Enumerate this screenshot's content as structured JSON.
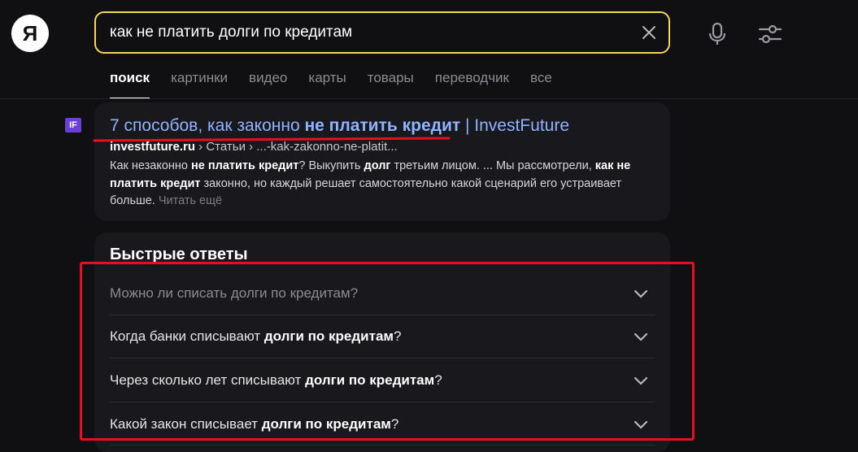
{
  "logo": {
    "letter": "Я"
  },
  "search": {
    "value": "как не платить долги по кредитам"
  },
  "tabs": [
    {
      "label": "поиск",
      "active": true
    },
    {
      "label": "картинки"
    },
    {
      "label": "видео"
    },
    {
      "label": "карты"
    },
    {
      "label": "товары"
    },
    {
      "label": "переводчик"
    },
    {
      "label": "все"
    }
  ],
  "result": {
    "favicon": "IF",
    "title_prefix": "7 способов, как законно ",
    "title_bold": "не платить кредит",
    "title_suffix": " | InvestFuture",
    "url_domain": "investfuture.ru",
    "url_path": " › Статьи › ...-kak-zakonno-ne-platit...",
    "snippet": [
      {
        "t": "Как незаконно "
      },
      {
        "t": "не платить кредит",
        "b": true
      },
      {
        "t": "? Выкупить "
      },
      {
        "t": "долг",
        "b": true
      },
      {
        "t": " третьим лицом. ... Мы рассмотрели, "
      },
      {
        "t": "как не платить кредит",
        "b": true
      },
      {
        "t": " законно, но каждый решает самостоятельно какой сценарий его устраивает больше. "
      }
    ],
    "read_more": "Читать ещё"
  },
  "quick_answers": {
    "title": "Быстрые ответы",
    "items": [
      {
        "prefix": "Можно ли списать долги по кредитам?",
        "bold": "",
        "suffix": ""
      },
      {
        "prefix": "Когда банки списывают ",
        "bold": "долги по кредитам",
        "suffix": "?"
      },
      {
        "prefix": "Через сколько лет списывают ",
        "bold": "долги по кредитам",
        "suffix": "?"
      },
      {
        "prefix": "Какой закон списывает ",
        "bold": "долги по кредитам",
        "suffix": "?"
      }
    ]
  },
  "colors": {
    "accent_yellow": "#f4d75a",
    "link_blue": "#8fb3ff",
    "annotation_red": "#e8101c"
  }
}
